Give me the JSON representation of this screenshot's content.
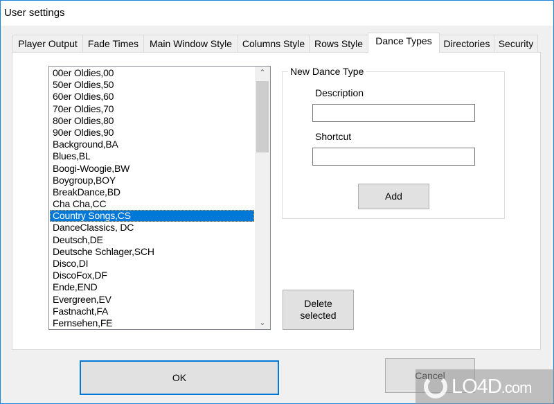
{
  "window": {
    "title": "User settings"
  },
  "tabs": [
    {
      "label": "Player Output",
      "active": false
    },
    {
      "label": "Fade Times",
      "active": false
    },
    {
      "label": "Main Window Style",
      "active": false
    },
    {
      "label": "Columns Style",
      "active": false
    },
    {
      "label": "Rows Style",
      "active": false
    },
    {
      "label": "Dance Types",
      "active": true
    },
    {
      "label": "Directories",
      "active": false
    },
    {
      "label": "Security",
      "active": false
    }
  ],
  "dance_list": {
    "items": [
      "00er Oldies,00",
      "50er Oldies,50",
      "60er Oldies,60",
      "70er Oldies,70",
      "80er Oldies,80",
      "90er Oldies,90",
      "Background,BA",
      "Blues,BL",
      "Boogi-Woogie,BW",
      "Boygroup,BOY",
      "BreakDance,BD",
      "Cha Cha,CC",
      "Country Songs,CS",
      "DanceClassics, DC",
      "Deutsch,DE",
      "Deutsche Schlager,SCH",
      "Disco,DI",
      "DiscoFox,DF",
      "Ende,END",
      "Evergreen,EV",
      "Fastnacht,FA",
      "Fernsehen,FE"
    ],
    "selected_index": 12,
    "scroll_up_icon": "chevron-up",
    "scroll_down_icon": "chevron-down"
  },
  "new_dance_type": {
    "group_label": "New Dance Type",
    "description_label": "Description",
    "description_value": "",
    "shortcut_label": "Shortcut",
    "shortcut_value": "",
    "add_label": "Add"
  },
  "actions": {
    "delete_label_line1": "Delete",
    "delete_label_line2": "selected",
    "ok_label": "OK",
    "cancel_label": "Cancel"
  },
  "watermark": {
    "text": "LO4D",
    "suffix": ".com"
  }
}
